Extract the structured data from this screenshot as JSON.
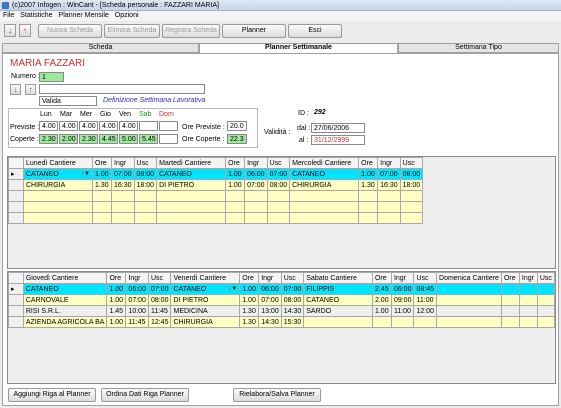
{
  "window": {
    "title": "(c)2007 Infogen : WinCant - [Scheda personale : FAZZARI MARIA]"
  },
  "menu": [
    "File",
    "Statistiche",
    "Planner Mensile",
    "Opzioni"
  ],
  "toolbar": {
    "nav_left_icon": "arrow-down-red",
    "nav_right_icon": "arrow-up-red",
    "nuova": "Nuova Scheda",
    "elimina": "Elimina Scheda",
    "registra": "Registra Scheda",
    "planner": "Planner",
    "esci": "Esci"
  },
  "tabs": [
    "Scheda",
    "Planner Settimanale",
    "Settimana Tipo"
  ],
  "person": {
    "name": "MARIA FAZZARI",
    "numero_label": "Numero :",
    "numero": "1",
    "status": "Valida"
  },
  "definizione": "Definizione Settimana Lavorativa",
  "week": {
    "days": [
      "Lun",
      "Mar",
      "Mer",
      "Gio",
      "Ven",
      "Sab",
      "Dom"
    ],
    "previste_label": "Previste :",
    "coperte_label": "Coperte :",
    "previste": [
      "4.00",
      "4.00",
      "4.00",
      "4.00",
      "4.00",
      "",
      ""
    ],
    "coperte": [
      "2.30",
      "2.00",
      "2.30",
      "4.45",
      "5.00",
      "5.45",
      ""
    ],
    "ore_previste_label": "Ore Previste :",
    "ore_previste": "20.0",
    "ore_coperte_label": "Ore Coperte :",
    "ore_coperte": "22.3"
  },
  "validity": {
    "id_label": "ID :",
    "id": "292",
    "validita_label": "Validità :",
    "dal_label": "dal :",
    "dal": "27/06/2006",
    "al_label": "al :",
    "al": "31/12/2999"
  },
  "grid1": {
    "headers": [
      "Lunedì  Cantiere",
      "Ore",
      "Ingr",
      "Usc",
      "Martedì Cantiere",
      "Ore",
      "Ingr",
      "Usc",
      "Mercoledì Cantiere",
      "Ore",
      "Ingr",
      "Usc"
    ],
    "rows": [
      [
        "CATANEO",
        "1.00",
        "07:00",
        "08:00",
        "CATANEO",
        "1.00",
        "06:00",
        "07:00",
        "CATANEO",
        "1.00",
        "07:00",
        "08:00"
      ],
      [
        "CHIRURGIA",
        "1.30",
        "16:30",
        "18:00",
        "DI PIETRO",
        "1.00",
        "07:00",
        "08:00",
        "CHIRURGIA",
        "1.30",
        "16:30",
        "18:00"
      ]
    ]
  },
  "grid2": {
    "headers": [
      "Giovedì  Cantiere",
      "Ore",
      "Ingr",
      "Usc",
      "Venerdì  Cantiere",
      "Ore",
      "Ingr",
      "Usc",
      "Sabato  Cantiere",
      "Ore",
      "Ingr",
      "Usc",
      "Domenica  Cantiere",
      "Ore",
      "Ingr",
      "Usc"
    ],
    "rows": [
      [
        "CATANEO",
        "1.00",
        "06:00",
        "07:00",
        "CATANEO",
        "1.00",
        "06:00",
        "07:00",
        "FILIPPIS",
        "2.45",
        "06:00",
        "08:45",
        "",
        "",
        "",
        ""
      ],
      [
        "CARNOVALE",
        "1.00",
        "07:00",
        "08:00",
        "DI PIETRO",
        "1.00",
        "07:00",
        "08:00",
        "CATANEO",
        "2.00",
        "09:00",
        "11:00",
        "",
        "",
        "",
        ""
      ],
      [
        "RISI S.R.L.",
        "1.45",
        "10:00",
        "11:45",
        "MEDICINA",
        "1.30",
        "13:00",
        "14:30",
        "SARDO",
        "1.00",
        "11:00",
        "12:00",
        "",
        "",
        "",
        ""
      ],
      [
        "AZIENDA AGRICOLA BA",
        "1.00",
        "11:45",
        "12:45",
        "CHIRURGIA",
        "1.30",
        "14:30",
        "15:30",
        "",
        "",
        "",
        "",
        "",
        "",
        "",
        ""
      ]
    ]
  },
  "bottom_buttons": {
    "aggiungi": "Aggiungi Riga al Planner",
    "ordina": "Ordina Dati Riga  Planner",
    "rielabora": "Rielabora/Salva  Planner"
  },
  "colors": {
    "selected_row": "#00e5ff",
    "alt_row": "#ffffc4",
    "name": "#e03030",
    "definizione": "#3030c0"
  }
}
